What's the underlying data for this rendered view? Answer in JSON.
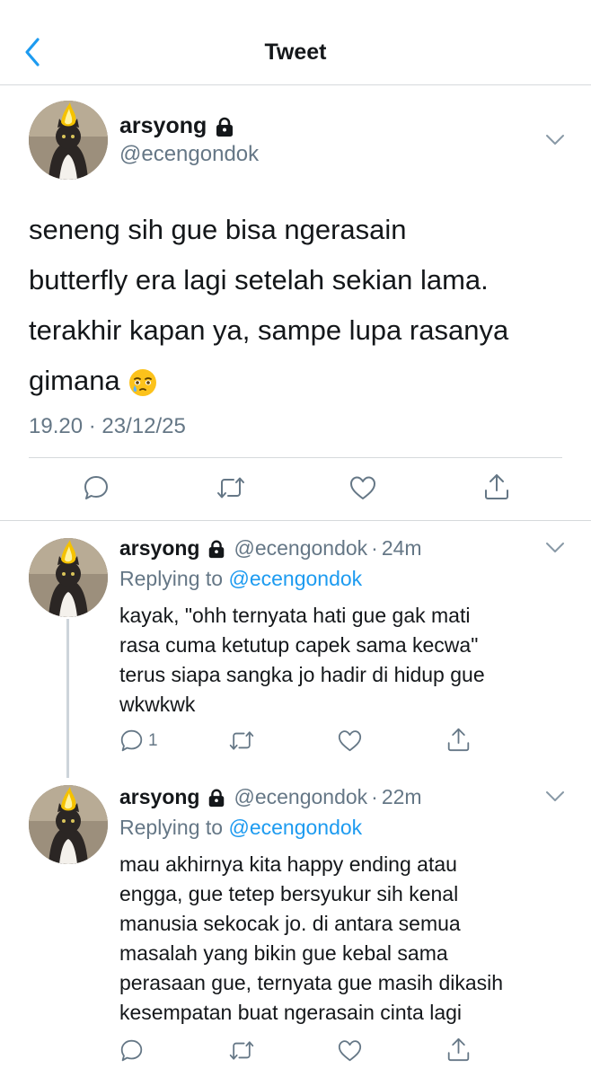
{
  "header": {
    "title": "Tweet"
  },
  "main_tweet": {
    "name": "arsyong",
    "handle": "@ecengondok",
    "text_lines": [
      "seneng sih gue bisa ngerasain",
      "butterfly era lagi setelah sekian lama.",
      "terakhir kapan ya, sampe lupa rasanya",
      "gimana"
    ],
    "emoji": "face-holding-back-tears",
    "timestamp": "19.20 · 23/12/25"
  },
  "replies": [
    {
      "name": "arsyong",
      "handle": "@ecengondok",
      "separator": "·",
      "age": "24m",
      "replying_prefix": "Replying to",
      "replying_to": "@ecengondok",
      "text_lines": [
        "kayak, \"ohh ternyata hati gue gak mati",
        "rasa cuma ketutup capek sama kecwa\"",
        "terus siapa sangka jo hadir di hidup gue",
        "wkwkwk"
      ],
      "reply_count": "1"
    },
    {
      "name": "arsyong",
      "handle": "@ecengondok",
      "separator": "·",
      "age": "22m",
      "replying_prefix": "Replying to",
      "replying_to": "@ecengondok",
      "text_lines": [
        "mau akhirnya kita happy ending atau",
        "engga, gue tetep bersyukur sih kenal",
        "manusia sekocak jo. di antara semua",
        "masalah yang bikin gue kebal sama",
        "perasaan gue, ternyata gue masih dikasih",
        "kesempatan buat ngerasain cinta lagi"
      ],
      "reply_count": ""
    }
  ],
  "icons": {
    "back": "chevron-left-icon",
    "lock": "lock-icon",
    "more": "chevron-down-icon",
    "reply": "comment-icon",
    "retweet": "retweet-icon",
    "like": "heart-icon",
    "share": "share-icon"
  },
  "colors": {
    "accent": "#1d9bf0",
    "text": "#14171a",
    "muted": "#657786",
    "divider": "#d6d9dc"
  }
}
